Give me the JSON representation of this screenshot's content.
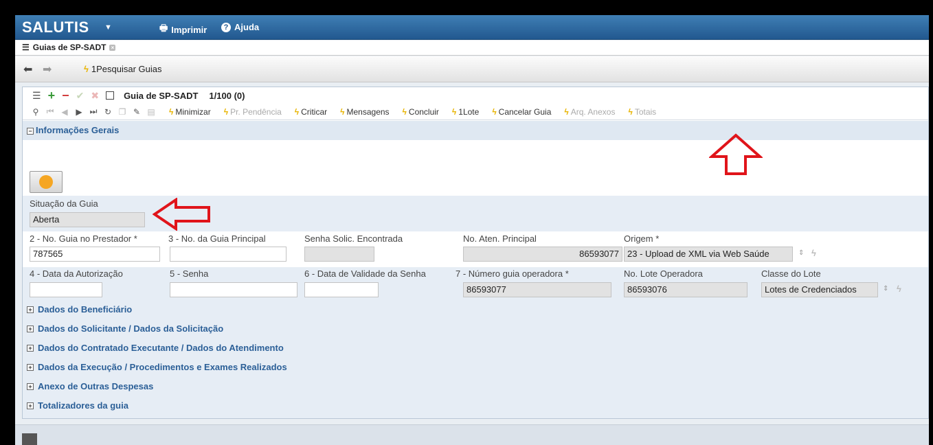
{
  "app": {
    "title": "SALUTIS",
    "menu_icon": "caret-down-icon",
    "print_label": "Imprimir",
    "help_label": "Ajuda"
  },
  "tabs": [
    {
      "label": "Guias de SP-SADT"
    }
  ],
  "nav": {
    "search_link": "1Pesquisar Guias"
  },
  "form": {
    "title": "Guia de SP-SADT",
    "record_counter": "1/100 (0)",
    "actions": [
      {
        "label": "Minimizar",
        "enabled": true
      },
      {
        "label": "Pr. Pendência",
        "enabled": false
      },
      {
        "label": "Criticar",
        "enabled": true
      },
      {
        "label": "Mensagens",
        "enabled": true
      },
      {
        "label": "Concluir",
        "enabled": true
      },
      {
        "label": "1Lote",
        "enabled": true
      },
      {
        "label": "Cancelar Guia",
        "enabled": true
      },
      {
        "label": "Arq. Anexos",
        "enabled": false
      },
      {
        "label": "Totais",
        "enabled": false
      }
    ]
  },
  "section_info": {
    "label": "Informações Gerais"
  },
  "status": {
    "color": "#f5a623",
    "situacao_label": "Situação da Guia",
    "situacao_value": "Aberta"
  },
  "fields": {
    "no_guia_prestador": {
      "label": "2 - No. Guia no Prestador *",
      "value": "787565"
    },
    "no_guia_principal": {
      "label": "3 - No. da Guia Principal",
      "value": ""
    },
    "senha_solic": {
      "label": "Senha Solic. Encontrada",
      "value": ""
    },
    "no_aten_principal": {
      "label": "No. Aten. Principal",
      "value": "86593077"
    },
    "origem": {
      "label": "Origem *",
      "value": "23 - Upload de XML via Web Saúde"
    },
    "data_autorizacao": {
      "label": "4 - Data da Autorização",
      "value": ""
    },
    "senha": {
      "label": "5 - Senha",
      "value": ""
    },
    "data_validade_senha": {
      "label": "6 - Data de Validade da Senha",
      "value": ""
    },
    "numero_guia_operadora": {
      "label": "7 - Número guia operadora *",
      "value": "86593077"
    },
    "no_lote_operadora": {
      "label": "No. Lote Operadora",
      "value": "86593076"
    },
    "classe_lote": {
      "label": "Classe do Lote",
      "value": "Lotes de Credenciados"
    }
  },
  "sections": [
    "Dados do Beneficiário",
    "Dados do Solicitante / Dados da Solicitação",
    "Dados do Contratado Executante / Dados do Atendimento",
    "Dados da Execução / Procedimentos e Exames Realizados",
    "Anexo de Outras Despesas",
    "Totalizadores da guia"
  ],
  "colors": {
    "appbar": "#2e6aa3",
    "section_text": "#2b5f97",
    "annotation": "#e0141a"
  }
}
